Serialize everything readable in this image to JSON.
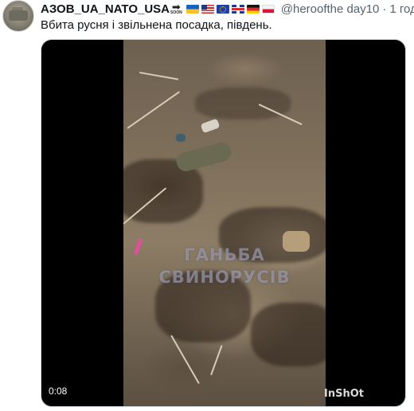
{
  "tweet": {
    "username": "АЗОВ_UA_NATO_USA",
    "soon_badge": "SOON",
    "soon_arrow": "➡",
    "flags": [
      "flag-ukraine-icon",
      "flag-usa-icon",
      "flag-eu-icon",
      "flag-uk-icon",
      "flag-germany-icon",
      "flag-poland-icon"
    ],
    "handle": "@heroofthe day10",
    "separator": "·",
    "time": "1 год",
    "text": "Вбита русня і звільнена посадка, південь."
  },
  "video": {
    "duration": "0:08",
    "watermark_line1": "ГАНЬБА",
    "watermark_line2": "СВИНОРУСІВ",
    "app_watermark": "InShOt"
  }
}
